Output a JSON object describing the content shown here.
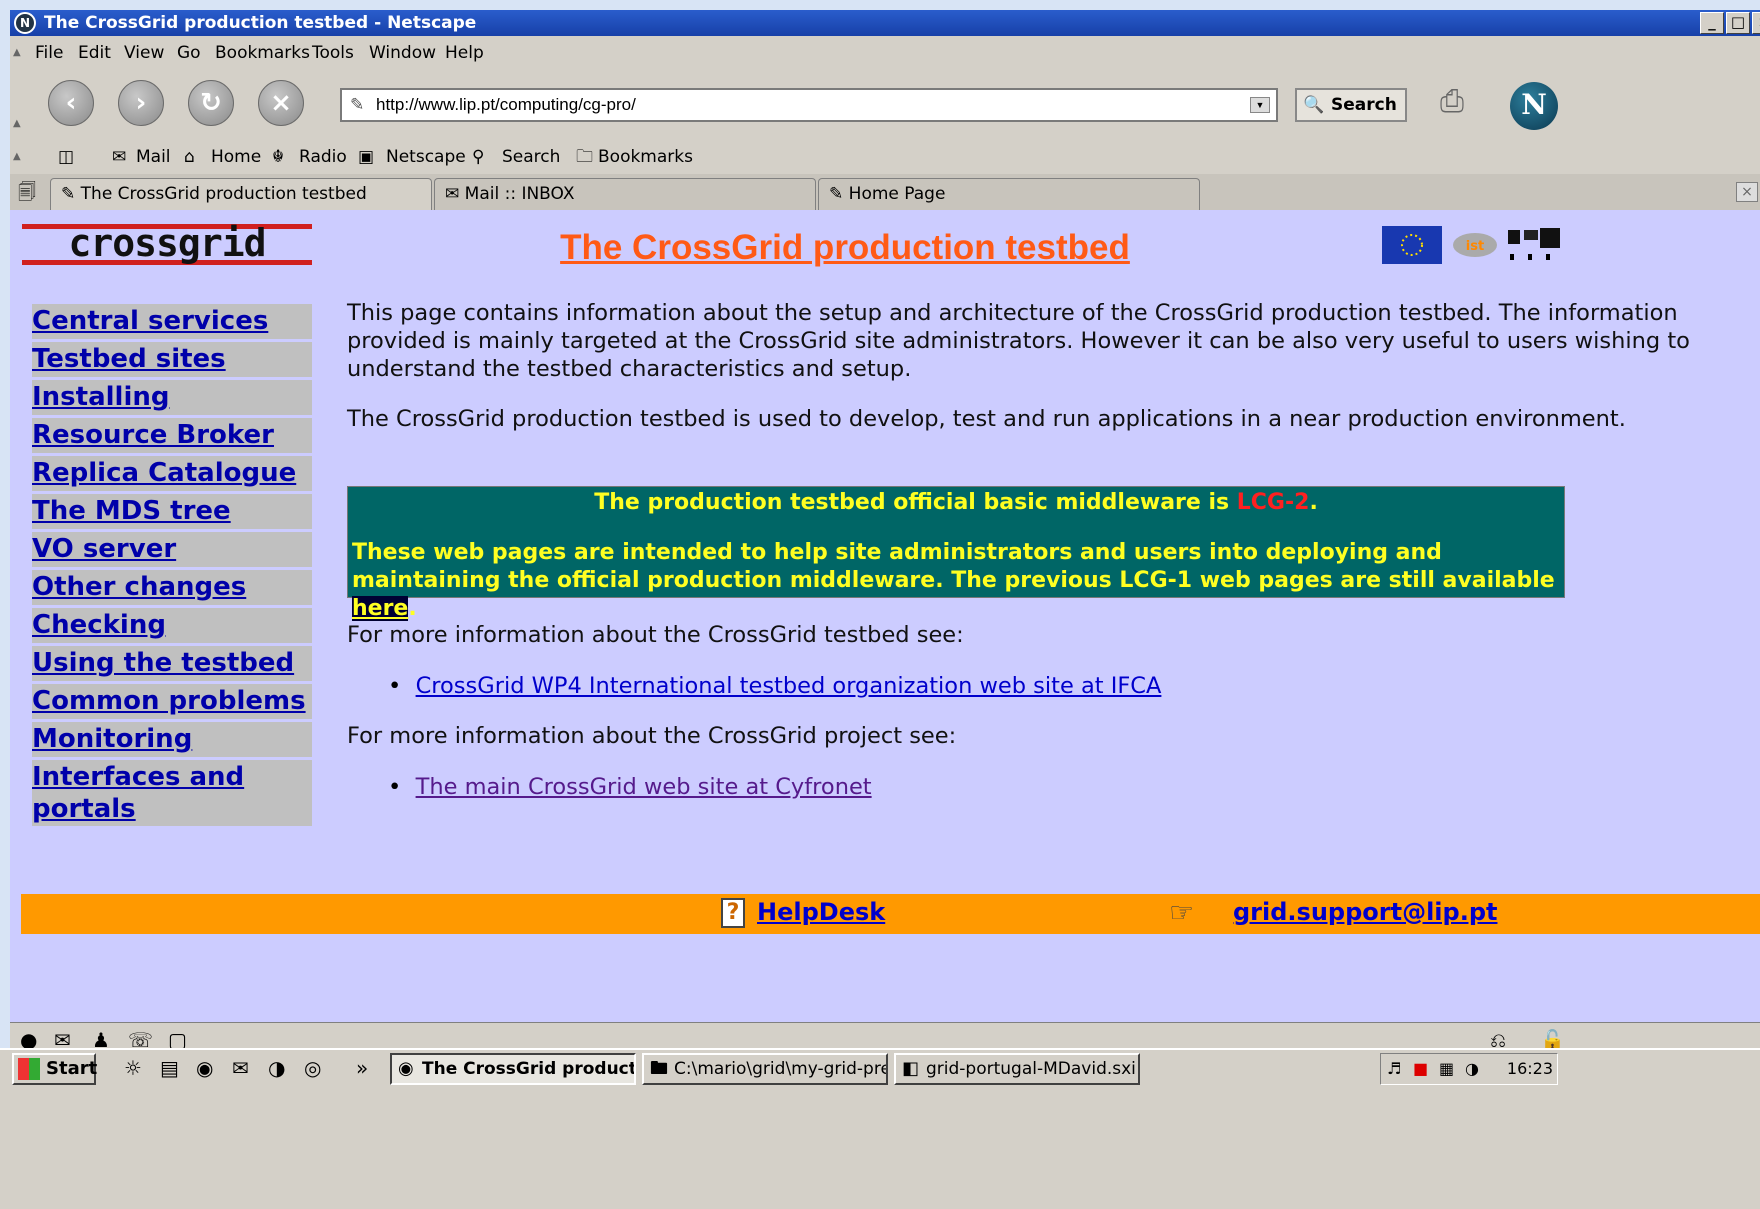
{
  "window": {
    "title": "The CrossGrid production testbed - Netscape",
    "controls": [
      "_",
      "□",
      "×"
    ]
  },
  "menu": [
    "File",
    "Edit",
    "View",
    "Go",
    "Bookmarks",
    "Tools",
    "Window",
    "Help"
  ],
  "navigation": {
    "url": "http://www.lip.pt/computing/cg-pro/",
    "search_label": "Search"
  },
  "personal_toolbar": [
    "Mail",
    "Home",
    "Radio",
    "Netscape",
    "Search",
    "Bookmarks"
  ],
  "tabs": [
    {
      "label": "The CrossGrid production testbed",
      "active": true
    },
    {
      "label": "Mail :: INBOX",
      "active": false
    },
    {
      "label": "Home Page",
      "active": false
    }
  ],
  "page": {
    "logo_text": "crossgrid",
    "title": "The CrossGrid production testbed",
    "sidebar": [
      "Central services",
      "Testbed sites",
      "Installing",
      "Resource Broker",
      "Replica Catalogue",
      "The MDS tree",
      "VO server",
      "Other changes",
      "Checking",
      "Using the testbed",
      "Common problems",
      "Monitoring",
      "Interfaces and portals"
    ],
    "intro_paragraph": "This page contains information about the setup and architecture of the CrossGrid production testbed. The information provided is mainly targeted at the CrossGrid site administrators. However it can be also very useful to users wishing to understand the testbed characteristics and setup.",
    "second_paragraph": "The CrossGrid production testbed is used to develop, test and run  applications in a near production environment.",
    "notice": {
      "line1_prefix": "The production testbed official basic middleware is ",
      "line1_highlight": "LCG-2",
      "line1_suffix": ".",
      "line2_text": "These web pages are intended to help site administrators and users into deploying and maintaining the official production middleware. The previous LCG-1 web pages are still available ",
      "line2_link": "here",
      "line2_suffix": "."
    },
    "more_testbed": "For more information about the CrossGrid testbed see:",
    "testbed_link": "CrossGrid WP4 International testbed organization web site at IFCA",
    "more_project": "For more information about the CrossGrid project see:",
    "project_link": "The main CrossGrid web site at Cyfronet",
    "footer": {
      "helpdesk": "HelpDesk",
      "email": "grid.support@lip.pt"
    }
  },
  "taskbar": {
    "start": "Start",
    "tasks": [
      {
        "label": "The CrossGrid product...",
        "active": true
      },
      {
        "label": "C:\\mario\\grid\\my-grid-pre...",
        "active": false
      },
      {
        "label": "grid-portugal-MDavid.sxi ...",
        "active": false
      }
    ],
    "clock": "16:23"
  },
  "colors": {
    "page_background": "#ccccff",
    "title_orange": "#ff5a16",
    "notice_background": "#006666",
    "notice_text": "#ffff22",
    "footer_orange": "#ff9900",
    "link_blue": "#0000cc"
  }
}
